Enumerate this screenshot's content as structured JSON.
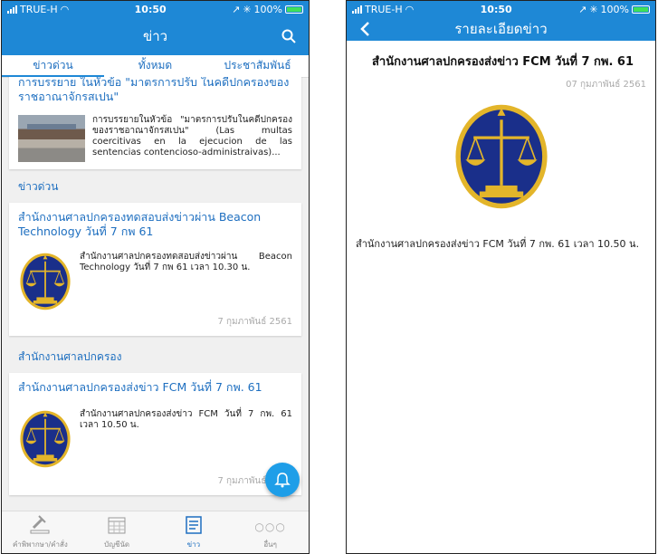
{
  "status": {
    "carrier": "TRUE-H",
    "time": "10:50",
    "battery": "100%"
  },
  "left": {
    "nav_title": "ข่าว",
    "icons": {
      "search": "search-icon"
    },
    "tabs": [
      {
        "label": "ข่าวด่วน",
        "active": true
      },
      {
        "label": "ทั้งหมด",
        "active": false
      },
      {
        "label": "ประชาสัมพันธ์",
        "active": false
      }
    ],
    "cards": [
      {
        "title": "การบรรยาย ในหัวข้อ \"มาตรการปรับ ในคดีปกครองของราชอาณาจักรสเปน\"",
        "text": "การบรรยายในหัวข้อ \"มาตรการปรับในคดีปกครองของราชอาณาจักรสเปน\" (Las multas coercitivas en la ejecucion de las sentencias contencioso-administraivas)..."
      }
    ],
    "sections": [
      {
        "label": "ข่าวด่วน",
        "card": {
          "title": "สำนักงานศาลปกครองทดสอบส่งข่าวผ่าน Beacon Technology วันที่ 7 กพ 61",
          "text": "สำนักงานศาลปกครองทดสอบส่งข่าวผ่าน Beacon Technology วันที่ 7 กพ 61 เวลา 10.30 น.",
          "date": "7 กุมภาพันธ์ 2561"
        }
      },
      {
        "label": "สำนักงานศาลปกครอง",
        "card": {
          "title": "สำนักงานศาลปกครองส่งข่าว FCM วันที่ 7 กพ. 61",
          "text": "สำนักงานศาลปกครองส่งข่าว FCM วันที่ 7 กพ. 61 เวลา 10.50 น.",
          "date": "7 กุมภาพันธ์ 2561"
        }
      }
    ],
    "tabbar": [
      {
        "label": "คำพิพากษา/คำสั่ง",
        "icon": "gavel-icon",
        "active": false
      },
      {
        "label": "บัญชีนัด",
        "icon": "calendar-icon",
        "active": false
      },
      {
        "label": "ข่าว",
        "icon": "news-icon",
        "active": true
      },
      {
        "label": "อื่นๆ",
        "icon": "more-icon",
        "active": false
      }
    ]
  },
  "right": {
    "nav_title": "รายละเอียดข่าว",
    "title": "สำนักงานศาลปกครองส่งข่าว FCM วันที่ 7 กพ. 61",
    "date": "07 กุมภาพันธ์ 2561",
    "body": "สำนักงานศาลปกครองส่งข่าว FCM วันที่ 7 กพ. 61 เวลา 10.50 น."
  },
  "colors": {
    "primary": "#1e88d6",
    "link": "#1e6fc0",
    "emblem_blue": "#1a2f8a",
    "emblem_gold": "#e3b52a"
  }
}
